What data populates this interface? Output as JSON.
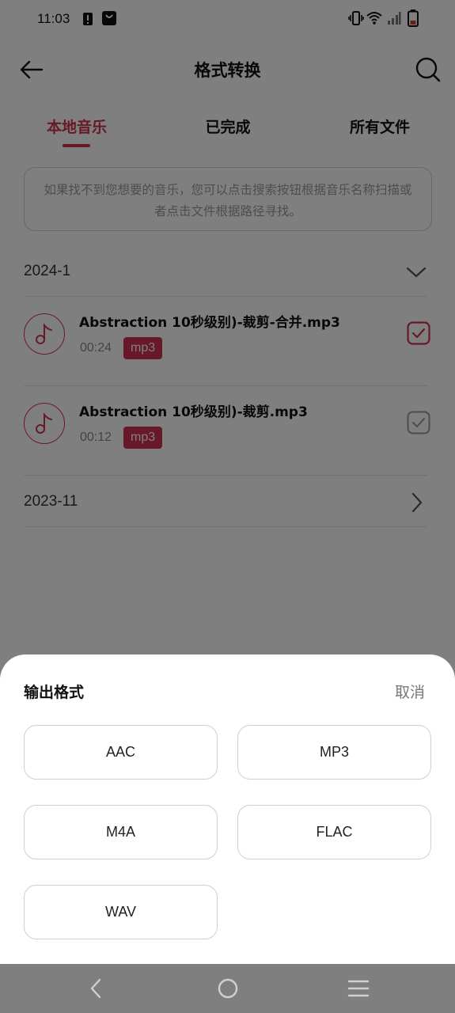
{
  "status_bar": {
    "time": "11:03",
    "icons": [
      "alert-icon",
      "shopping-bag-icon",
      "vibrate-icon",
      "wifi-icon",
      "cell-signal-icon",
      "battery-low-icon"
    ]
  },
  "header": {
    "title": "格式转换",
    "back_icon": "arrow-left-icon",
    "search_icon": "search-icon"
  },
  "tabs": [
    {
      "label": "本地音乐",
      "active": true
    },
    {
      "label": "已完成",
      "active": false
    },
    {
      "label": "所有文件",
      "active": false
    }
  ],
  "tip": "如果找不到您想要的音乐，您可以点击搜索按钮根据音乐名称扫描或者点击文件根据路径寻找。",
  "groups": [
    {
      "label": "2024-1",
      "expanded": true,
      "songs": [
        {
          "name": "Abstraction 10秒级别)-裁剪-合并.mp3",
          "duration": "00:24",
          "format": "mp3",
          "selected": true
        },
        {
          "name": "Abstraction 10秒级别)-裁剪.mp3",
          "duration": "00:12",
          "format": "mp3",
          "selected": false
        }
      ]
    },
    {
      "label": "2023-11",
      "expanded": false
    }
  ],
  "sheet": {
    "title": "输出格式",
    "cancel": "取消",
    "options": [
      "AAC",
      "MP3",
      "M4A",
      "FLAC",
      "WAV"
    ]
  },
  "colors": {
    "accent": "#d03352",
    "overlay": "rgba(0,0,0,0.5)",
    "nav_bar": "#7f7f7f"
  }
}
